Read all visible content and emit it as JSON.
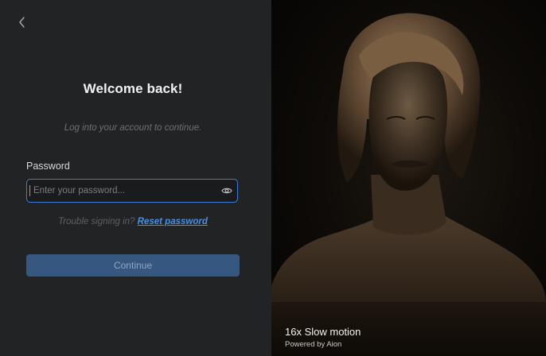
{
  "login": {
    "title": "Welcome back!",
    "subtitle": "Log into your account to continue.",
    "password_label": "Password",
    "password_placeholder": "Enter your password...",
    "password_value": "",
    "trouble_text": "Trouble signing in?",
    "reset_link": "Reset password",
    "continue_label": "Continue"
  },
  "media": {
    "caption_title": "16x Slow motion",
    "caption_sub": "Powered by Aion"
  },
  "icons": {
    "back": "chevron-left-icon",
    "eye": "eye-icon"
  },
  "colors": {
    "panel_bg": "#222325",
    "accent": "#3e7fd6",
    "link": "#4a8fe0",
    "button_bg": "#36577f"
  }
}
